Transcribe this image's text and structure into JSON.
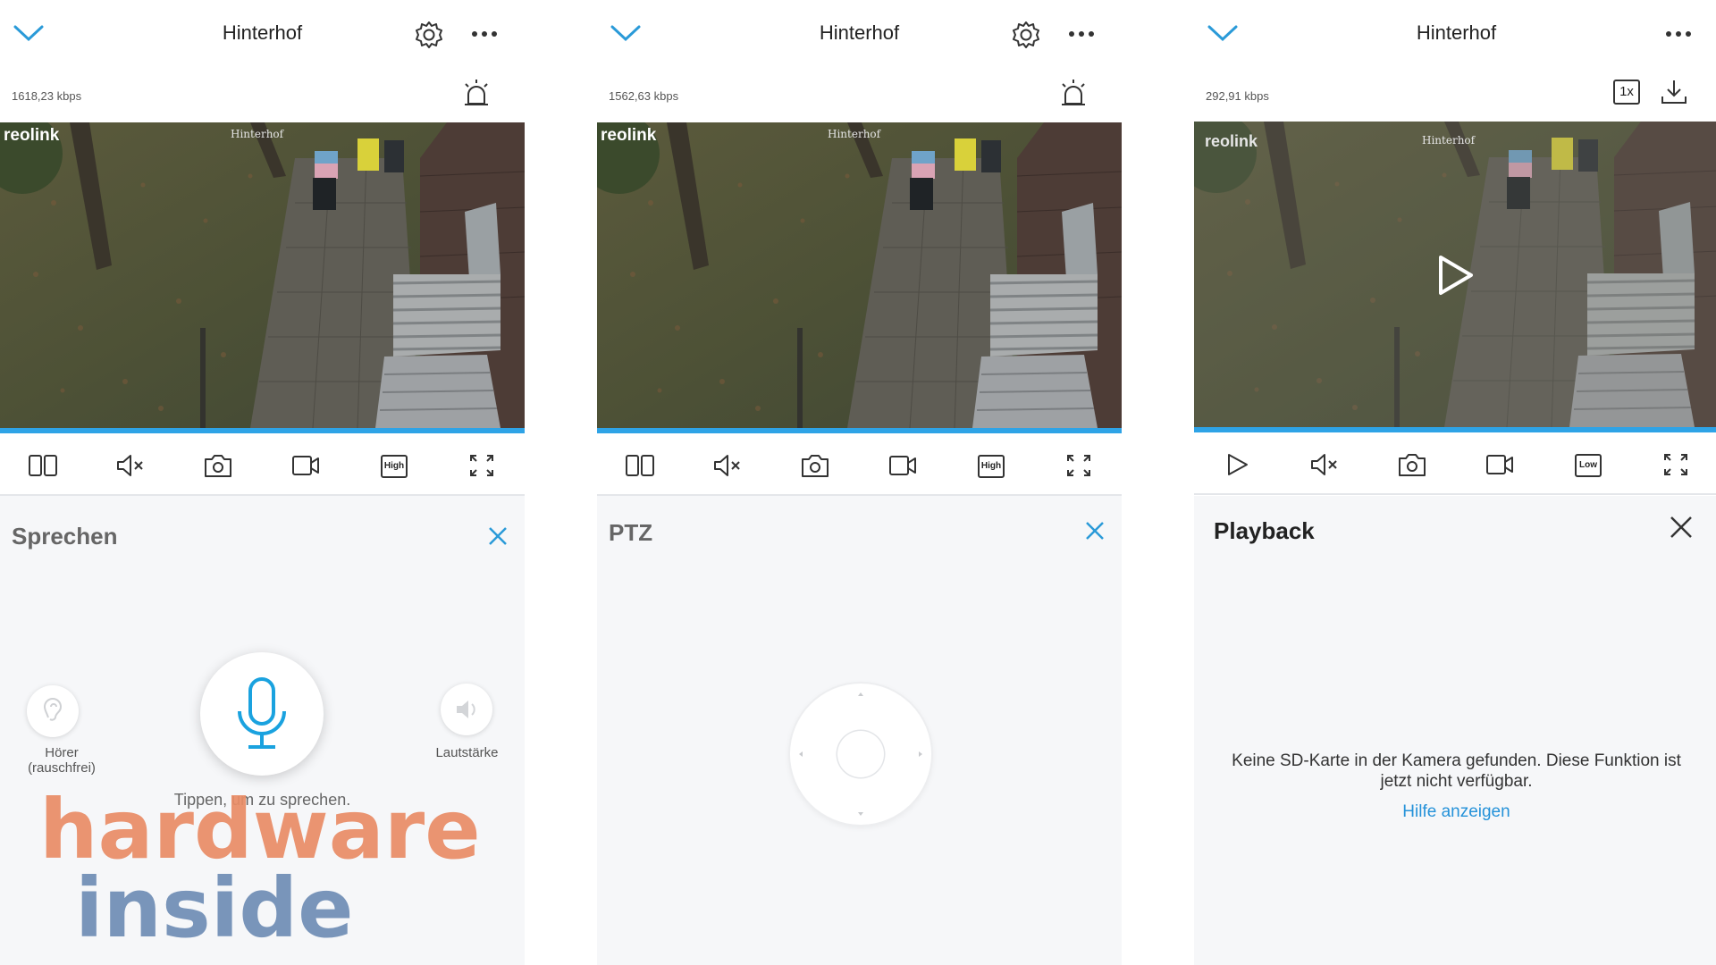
{
  "colors": {
    "accent": "#2592d9",
    "progress": "#2ea3e6",
    "sheet_bg": "#f6f7f9"
  },
  "panels": [
    {
      "title": "Hinterhof",
      "bitrate": "1618,23 kbps",
      "video": {
        "brand": "reolink",
        "camera_label": "Hinterhof"
      },
      "quality": "High",
      "sheet": {
        "title": "Sprechen",
        "earpiece_label_line1": "Hörer",
        "earpiece_label_line2": "(rauschfrei)",
        "volume_label": "Lautstärke",
        "hint": "Tippen, um zu sprechen."
      },
      "watermark": {
        "line1": "hardware",
        "line2": "inside"
      }
    },
    {
      "title": "Hinterhof",
      "bitrate": "1562,63 kbps",
      "video": {
        "brand": "reolink",
        "camera_label": "Hinterhof"
      },
      "quality": "High",
      "sheet": {
        "title": "PTZ"
      }
    },
    {
      "title": "Hinterhof",
      "bitrate": "292,91 kbps",
      "video": {
        "brand": "reolink",
        "camera_label": "Hinterhof"
      },
      "quality": "Low",
      "speed": "1x",
      "sheet": {
        "title": "Playback",
        "message": "Keine SD-Karte in der Kamera gefunden. Diese Funktion ist jetzt nicht verfügbar.",
        "help_link": "Hilfe anzeigen"
      }
    }
  ],
  "icons": [
    "chevron-down-icon",
    "gear-icon",
    "more-icon",
    "alarm-icon",
    "split-view-icon",
    "mute-icon",
    "snapshot-icon",
    "record-icon",
    "quality-icon",
    "fullscreen-icon",
    "play-icon",
    "download-icon",
    "close-icon",
    "microphone-icon",
    "ear-icon",
    "volume-icon"
  ]
}
